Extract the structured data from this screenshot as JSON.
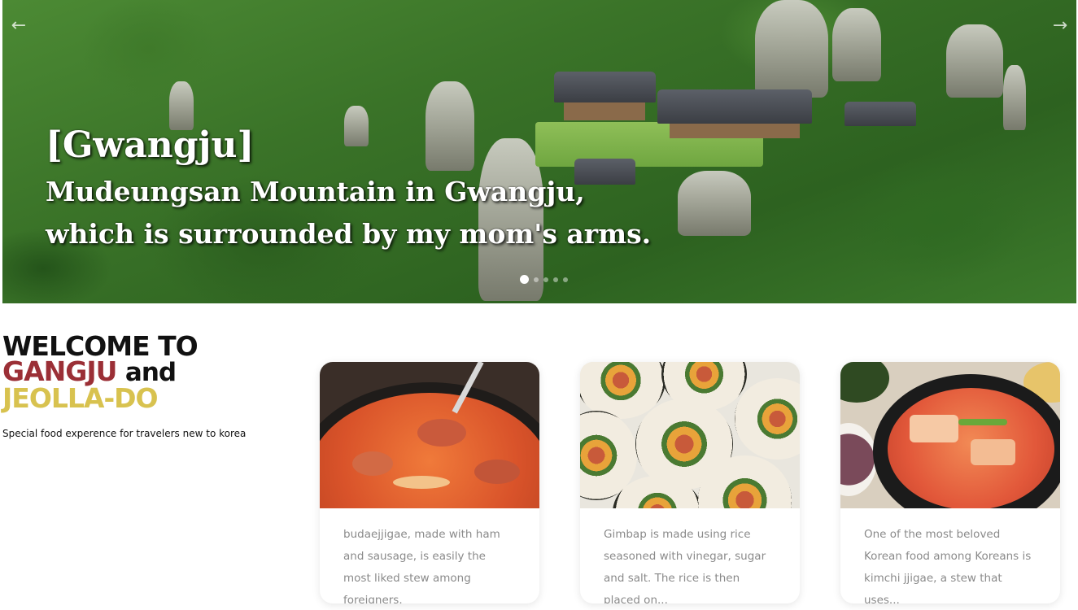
{
  "hero": {
    "title": "[Gwangju]",
    "line1": "Mudeungsan Mountain in Gwangju,",
    "line2": "which is surrounded by my mom's arms.",
    "prev_icon": "←",
    "next_icon": "→",
    "slide_count": 5,
    "active_slide": 1
  },
  "welcome": {
    "line1": "WELCOME TO",
    "line2_red": "GANGJU",
    "line2_and": "and",
    "line3": "JEOLLA-DO",
    "subtitle": "Special food experence for travelers new to korea",
    "colors": {
      "red": "#9b2f36",
      "yellow": "#d8c24f"
    }
  },
  "cards": [
    {
      "image": "budae-jjigae-photo",
      "text": "budaejjigae, made with ham and sausage, is easily the most liked stew among foreigners."
    },
    {
      "image": "gimbap-photo",
      "text": "Gimbap is made using rice seasoned with vinegar, sugar and salt. The rice is then placed on..."
    },
    {
      "image": "kimchi-jjigae-photo",
      "text": "One of the most beloved Korean food among Koreans is kimchi jjigae, a stew that uses..."
    }
  ]
}
